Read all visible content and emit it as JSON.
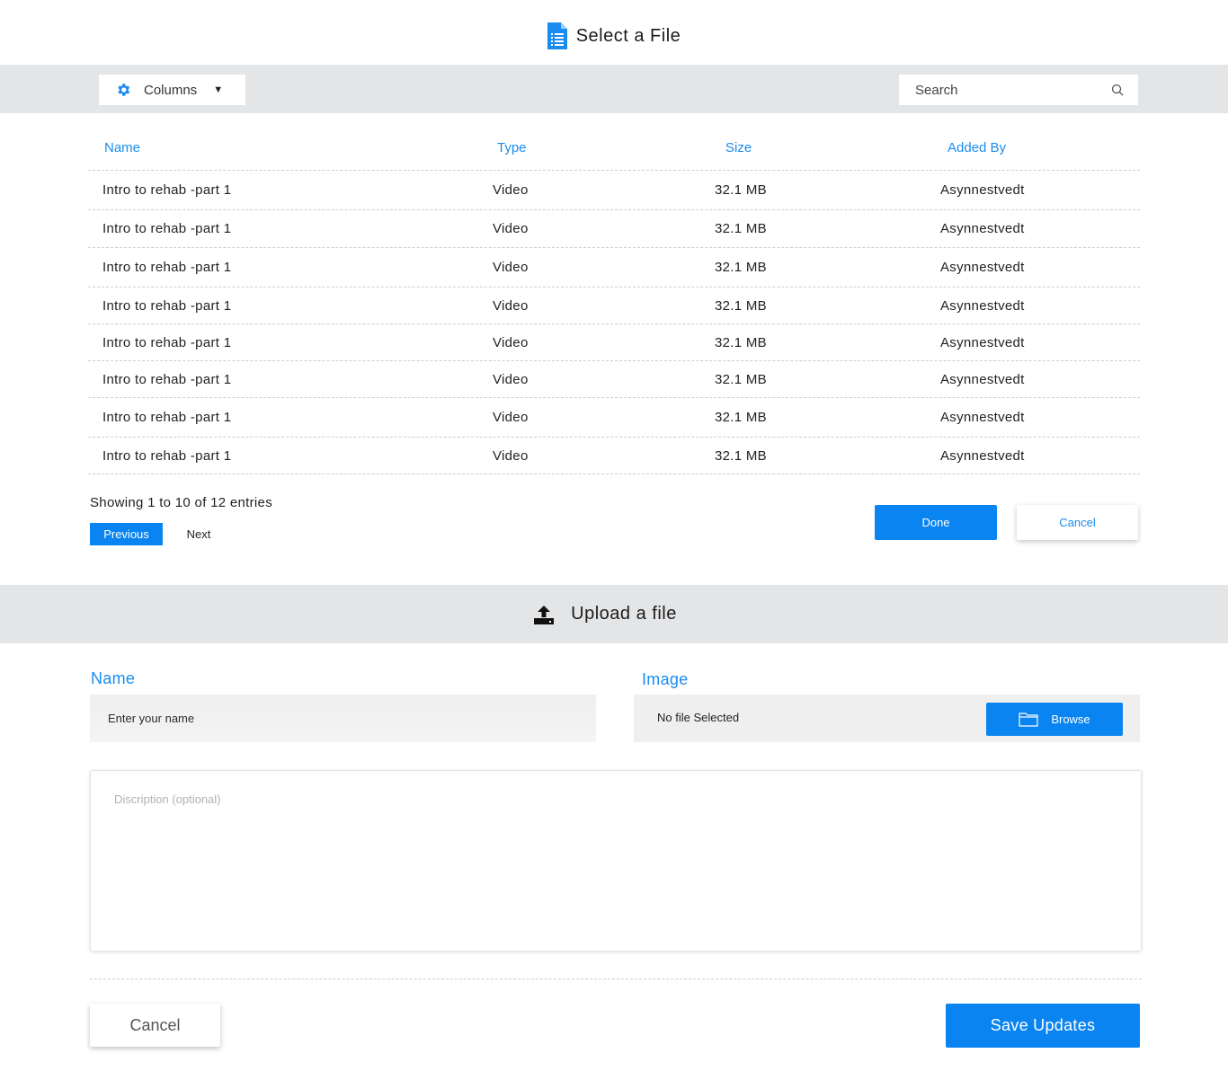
{
  "header": {
    "title": "Select a File",
    "icon": "document-icon"
  },
  "toolbar": {
    "columns_label": "Columns",
    "columns_icon": "gear-icon",
    "search_placeholder": "Search"
  },
  "table": {
    "headers": {
      "name": "Name",
      "type": "Type",
      "size": "Size",
      "added_by": "Added By"
    },
    "rows": [
      {
        "name": "Intro to rehab -part 1",
        "type": "Video",
        "size": "32.1 MB",
        "added_by": "Asynnestvedt"
      },
      {
        "name": "Intro to rehab -part 1",
        "type": "Video",
        "size": "32.1 MB",
        "added_by": "Asynnestvedt"
      },
      {
        "name": "Intro to rehab -part 1",
        "type": "Video",
        "size": "32.1 MB",
        "added_by": "Asynnestvedt"
      },
      {
        "name": "Intro to rehab -part 1",
        "type": "Video",
        "size": "32.1 MB",
        "added_by": "Asynnestvedt"
      },
      {
        "name": "Intro to rehab -part 1",
        "type": "Video",
        "size": "32.1 MB",
        "added_by": "Asynnestvedt"
      },
      {
        "name": "Intro to rehab -part 1",
        "type": "Video",
        "size": "32.1 MB",
        "added_by": "Asynnestvedt"
      },
      {
        "name": "Intro to rehab -part 1",
        "type": "Video",
        "size": "32.1 MB",
        "added_by": "Asynnestvedt"
      },
      {
        "name": "Intro to rehab -part 1",
        "type": "Video",
        "size": "32.1 MB",
        "added_by": "Asynnestvedt"
      }
    ]
  },
  "pagination": {
    "summary": "Showing 1 to 10 of 12 entries",
    "previous_label": "Previous",
    "next_label": "Next"
  },
  "select_actions": {
    "done_label": "Done",
    "cancel_label": "Cancel"
  },
  "upload": {
    "title": "Upload a file",
    "icon": "upload-icon",
    "name_label": "Name",
    "name_placeholder": "Enter your name",
    "image_label": "Image",
    "image_status": "No file Selected",
    "browse_label": "Browse",
    "description_placeholder": "Discription (optional)"
  },
  "footer": {
    "cancel_label": "Cancel",
    "save_label": "Save Updates"
  },
  "colors": {
    "accent": "#0a84f0",
    "toolbar_bg": "#e4e5e7",
    "header_text": "#1a8cf0"
  }
}
